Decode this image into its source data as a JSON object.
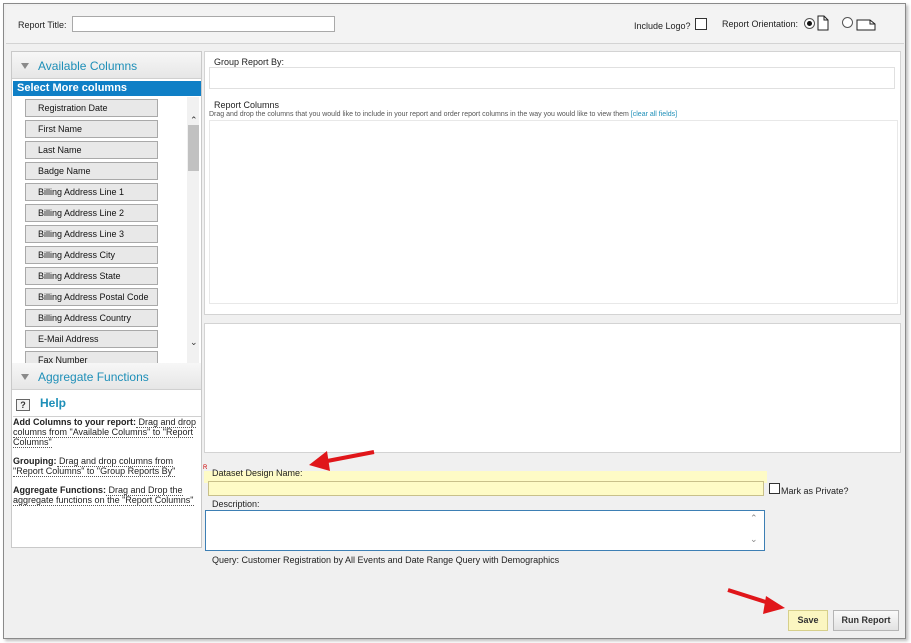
{
  "header": {
    "report_title_label": "Report Title:",
    "report_title_value": "",
    "include_logo_label": "Include Logo?",
    "orientation_label": "Report Orientation:"
  },
  "available_columns": {
    "title": "Available Columns",
    "select_more": "Select More columns",
    "items": [
      "Registration Date",
      "First Name",
      "Last Name",
      "Badge Name",
      "Billing Address Line 1",
      "Billing Address Line 2",
      "Billing Address Line 3",
      "Billing Address City",
      "Billing Address State",
      "Billing Address Postal Code",
      "Billing Address Country",
      "E-Mail Address",
      "Fax Number"
    ]
  },
  "aggregate_functions": {
    "title": "Aggregate Functions"
  },
  "help": {
    "title": "Help",
    "sections": [
      {
        "bold": "Add Columns to your report:",
        "text": " Drag and drop columns from \"Available Columns\" to \"Report Columns\""
      },
      {
        "bold": "Grouping:",
        "text": " Drag and drop columns from \"Report Columns\" to \"Group Reports By\""
      },
      {
        "bold": "Aggregate Functions:",
        "text": " Drag and Drop the aggregate functions on the \"Report Columns\""
      }
    ]
  },
  "group_by": {
    "label": "Group Report By:"
  },
  "report_columns": {
    "label": "Report Columns",
    "instructions": "Drag and drop the columns that you would like to include in your report and order report columns in the way you would like to view them",
    "clear_link": "[clear all fields]"
  },
  "dataset": {
    "required_marker": "R",
    "name_label": "Dataset Design Name:",
    "name_value": "",
    "mark_private_label": "Mark as Private?",
    "description_label": "Description:",
    "description_value": "",
    "query_text": "Query: Customer Registration by All Events and Date Range Query with Demographics"
  },
  "buttons": {
    "save": "Save",
    "run_report": "Run Report"
  },
  "colors": {
    "accent": "#1e8fb8",
    "select_bar": "#0f7fc6",
    "highlight": "#fefbc6",
    "arrow": "#e0161a"
  },
  "icons": {
    "portrait": "portrait-page-icon",
    "landscape": "landscape-page-icon",
    "help": "help-icon"
  }
}
